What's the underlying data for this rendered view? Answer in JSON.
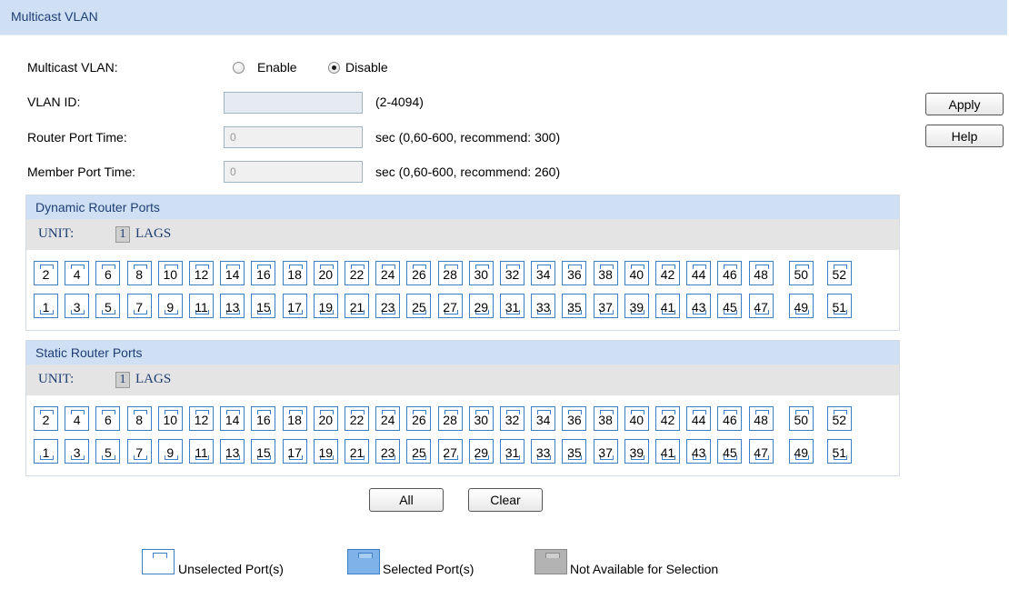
{
  "title": "Multicast VLAN",
  "form": {
    "multicast_vlan_label": "Multicast VLAN:",
    "enable_label": "Enable",
    "disable_label": "Disable",
    "enabled": false,
    "vlan_id_label": "VLAN ID:",
    "vlan_id_value": "",
    "vlan_id_hint": "(2-4094)",
    "router_port_time_label": "Router Port Time:",
    "router_port_time_value": "0",
    "router_port_time_hint": "sec (0,60-600, recommend: 300)",
    "member_port_time_label": "Member Port Time:",
    "member_port_time_value": "0",
    "member_port_time_hint": "sec (0,60-600, recommend: 260)"
  },
  "buttons": {
    "apply": "Apply",
    "help": "Help",
    "all": "All",
    "clear": "Clear"
  },
  "panels": [
    {
      "title": "Dynamic Router Ports",
      "unit_label": "UNIT:",
      "unit_value": "1",
      "lags_label": "LAGS"
    },
    {
      "title": "Static Router Ports",
      "unit_label": "UNIT:",
      "unit_value": "1",
      "lags_label": "LAGS"
    }
  ],
  "ports": {
    "top_row": [
      "2",
      "4",
      "6",
      "8",
      "10",
      "12",
      "14",
      "16",
      "18",
      "20",
      "22",
      "24",
      "26",
      "28",
      "30",
      "32",
      "34",
      "36",
      "38",
      "40",
      "42",
      "44",
      "46",
      "48",
      "50",
      "52"
    ],
    "bottom_row": [
      "1",
      "3",
      "5",
      "7",
      "9",
      "11",
      "13",
      "15",
      "17",
      "19",
      "21",
      "23",
      "25",
      "27",
      "29",
      "31",
      "33",
      "35",
      "37",
      "39",
      "41",
      "43",
      "45",
      "47",
      "49",
      "51"
    ]
  },
  "legend": {
    "unselected": "Unselected Port(s)",
    "selected": "Selected Port(s)",
    "not_available": "Not Available for Selection"
  },
  "colors": {
    "header_bg": "#cfe0f5",
    "port_border": "#3d7fc4",
    "selected_fill": "#7fb2e8",
    "unavailable_fill": "#b3b3b3"
  }
}
